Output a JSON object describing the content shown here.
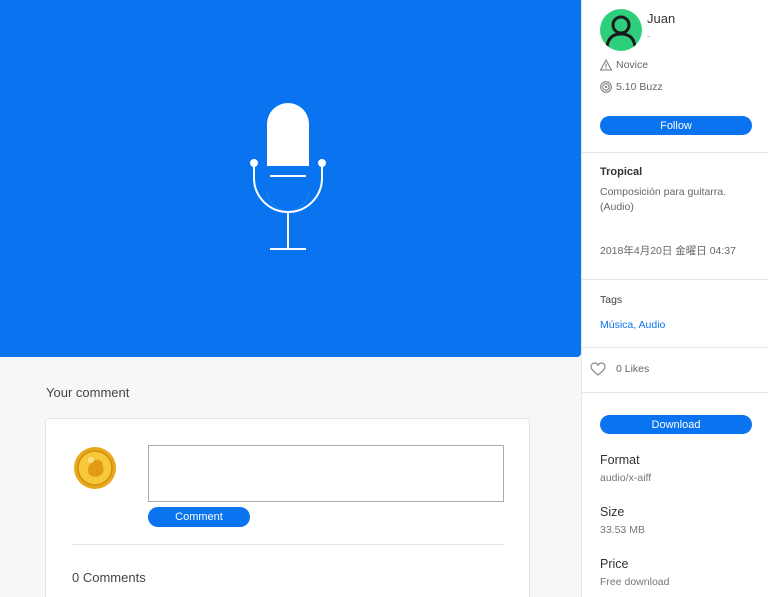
{
  "user": {
    "name": "Juan",
    "subtitle": "-",
    "level": "Novice",
    "buzz": "5.10 Buzz",
    "follow_label": "Follow"
  },
  "post": {
    "title": "Tropical",
    "description": "Composición para guitarra. (Audio)",
    "date": "2018年4月20日 金曜日 04:37"
  },
  "tags": {
    "heading": "Tags",
    "links": "Música, Audio"
  },
  "likes": {
    "label": "0 Likes"
  },
  "download": {
    "label": "Download"
  },
  "details": {
    "format_label": "Format",
    "format_value": "audio/x-aiff",
    "size_label": "Size",
    "size_value": "33.53 MB",
    "price_label": "Price",
    "price_value": "Free download"
  },
  "comments": {
    "heading": "Your comment",
    "button_label": "Comment",
    "count_label": "0 Comments"
  },
  "colors": {
    "accent": "#0a74f0",
    "avatar": "#2ecf7c"
  }
}
